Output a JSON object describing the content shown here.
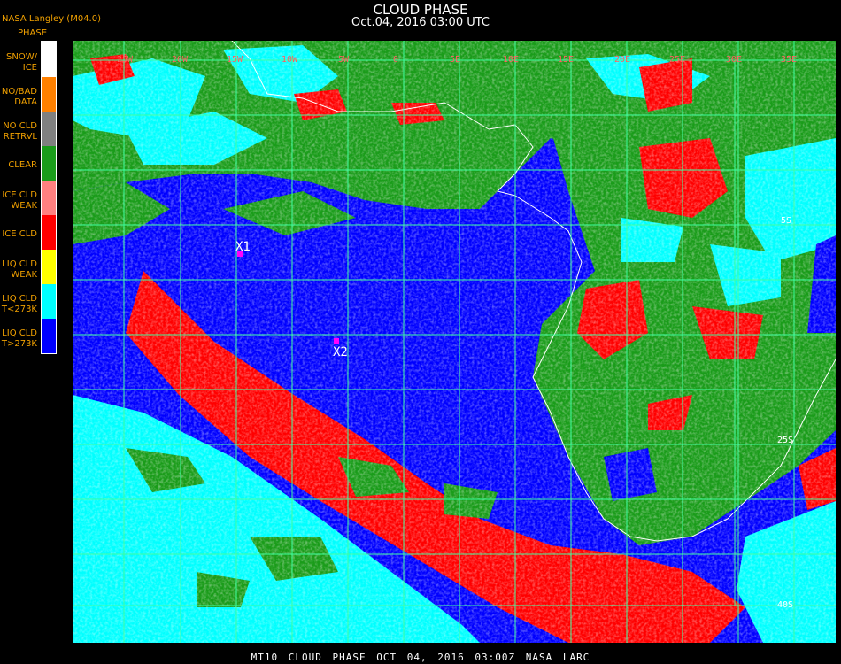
{
  "header": {
    "title": "CLOUD PHASE",
    "date": "Oct.04, 2016 03:00 UTC",
    "source": "NASA Langley (M04.0)"
  },
  "legend": {
    "title": "PHASE",
    "items": [
      {
        "label": "SNOW/\nICE",
        "color": "#ffffff"
      },
      {
        "label": "NO/BAD\nDATA",
        "color": "#ff8000"
      },
      {
        "label": "NO CLD\nRETRVL",
        "color": "#808080"
      },
      {
        "label": "CLEAR",
        "color": "#1a9c1a"
      },
      {
        "label": "ICE CLD\nWEAK",
        "color": "#ff8080"
      },
      {
        "label": "ICE CLD",
        "color": "#ff0000"
      },
      {
        "label": "LIQ CLD\nWEAK",
        "color": "#ffff00"
      },
      {
        "label": "LIQ CLD\nT<273K",
        "color": "#00ffff"
      },
      {
        "label": "LIQ CLD\nT>273K",
        "color": "#0000ff"
      }
    ]
  },
  "map": {
    "lon_labels": [
      "25W",
      "20W",
      "15W",
      "10W",
      "5W",
      "0",
      "5E",
      "10E",
      "15E",
      "20E",
      "25E",
      "30E",
      "35E"
    ],
    "lat_labels": [
      "5S",
      "25S",
      "40S"
    ],
    "markers": [
      {
        "label": "X1",
        "color": "#ff00ff"
      },
      {
        "label": "X2",
        "color": "#ff00ff"
      }
    ],
    "grid_color": "#40ffa0"
  },
  "footer": "MT10  CLOUD PHASE   OCT 04, 2016 03:00Z   NASA LARC"
}
